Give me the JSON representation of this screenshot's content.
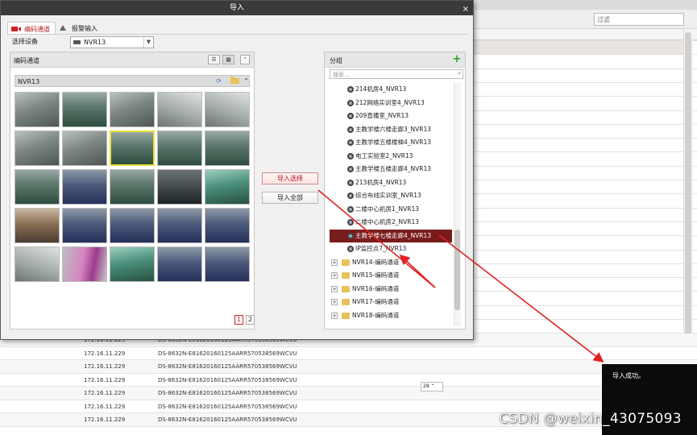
{
  "background": {
    "filter_placeholder": "过滤",
    "rows": [
      {
        "ip": "172.16.11.229",
        "device": "DS-8632N-E81620160125AARR570538569WCVU"
      },
      {
        "ip": "172.16.11.229",
        "device": "DS-8632N-E81620160125AARR570538569WCVU"
      },
      {
        "ip": "172.16.11.229",
        "device": "DS-8632N-E81620160125AARR570538569WCVU"
      },
      {
        "ip": "172.16.11.229",
        "device": "DS-8632N-E81620160125AARR570538569WCVU"
      },
      {
        "ip": "172.16.11.229",
        "device": "DS-8632N-E81620160125AARR570538569WCVU"
      },
      {
        "ip": "172.16.11.229",
        "device": "DS-8632N-E81620160125AARR570538569WCVU"
      },
      {
        "ip": "172.16.11.229",
        "device": "DS-8632N-E81620160125AARR570538569WCVU"
      }
    ],
    "spin_value": "28",
    "toast": "导入成功。",
    "watermark": "CSDN @weixin_43075093"
  },
  "dialog": {
    "title": "导入",
    "close_glyph": "×",
    "tabs": [
      {
        "label": "编码通道",
        "icon": "camera-icon",
        "active": true
      },
      {
        "label": "报警输入",
        "icon": "alarm-input-icon",
        "active": false
      }
    ],
    "device_label": "选择设备",
    "device_value": "NVR13",
    "left_panel": {
      "title": "编码通道",
      "nvr_label": "NVR13",
      "pages": [
        "1",
        "2"
      ],
      "active_page": "1",
      "thumbnails": [
        "corridor",
        "lab",
        "corridor",
        "stair",
        "stair",
        "corridor",
        "corridor",
        "lab-selected",
        "lab",
        "lab",
        "lab",
        "class",
        "lab",
        "dark",
        "teal",
        "door",
        "class",
        "class",
        "class",
        "class",
        "stair",
        "pink",
        "teal",
        "class",
        "class"
      ]
    },
    "buttons": {
      "import_selected": "导入选择",
      "import_all": "导入全部"
    },
    "right_panel": {
      "title": "分组",
      "search_placeholder": "搜索...",
      "channels": [
        "214机房4_NVR13",
        "212网络实训室4_NVR13",
        "209直播室_NVR13",
        "主教学楼六楼走廊3_NVR13",
        "主教学楼五楼楼梯4_NVR13",
        "电工实验室2_NVR13",
        "主教学楼五楼走廊4_NVR13",
        "213机房4_NVR13",
        "综合布线实训室_NVR13",
        "二楼中心机房1_NVR13",
        "二楼中心机房2_NVR13",
        "主教学楼七楼走廊4_NVR13",
        "IP监控点7_NVR13"
      ],
      "selected_index": 11,
      "groups": [
        "NVR14-编码通道",
        "NVR15-编码通道",
        "NVR16-编码通道",
        "NVR17-编码通道",
        "NVR18-编码通道"
      ]
    }
  },
  "colors": {
    "title_bar": "#3a3a3a",
    "accent": "#b51f1f",
    "selected_row": "#7a1c1c",
    "arrow": "#e02020",
    "toast_bg": "#0b0b0b"
  }
}
